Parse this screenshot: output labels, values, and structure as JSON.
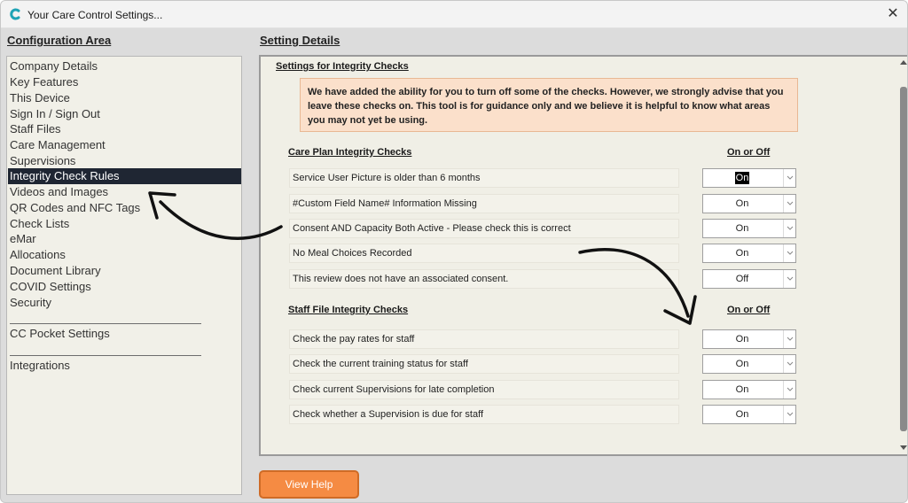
{
  "window": {
    "title": "Your Care Control Settings...",
    "close_label": "✕",
    "logo": "care-control-logo-icon"
  },
  "left": {
    "header": "Configuration Area",
    "items": [
      {
        "label": "Company Details",
        "selected": false
      },
      {
        "label": "Key Features",
        "selected": false
      },
      {
        "label": "This Device",
        "selected": false
      },
      {
        "label": "Sign In / Sign Out",
        "selected": false
      },
      {
        "label": "Staff Files",
        "selected": false
      },
      {
        "label": "Care Management",
        "selected": false
      },
      {
        "label": "Supervisions",
        "selected": false
      },
      {
        "label": "Integrity Check Rules",
        "selected": true
      },
      {
        "label": "Videos and Images",
        "selected": false
      },
      {
        "label": "QR Codes and NFC Tags",
        "selected": false
      },
      {
        "label": "Check Lists",
        "selected": false
      },
      {
        "label": "eMar",
        "selected": false
      },
      {
        "label": "Allocations",
        "selected": false
      },
      {
        "label": "Document Library",
        "selected": false
      },
      {
        "label": "COVID Settings",
        "selected": false
      },
      {
        "label": "Security",
        "selected": false
      }
    ],
    "group2": [
      {
        "label": "CC Pocket Settings"
      }
    ],
    "group3": [
      {
        "label": "Integrations"
      }
    ]
  },
  "right": {
    "header": "Setting Details",
    "settings_title": "Settings for Integrity Checks",
    "notice": "We have added the ability for you to turn off some of the checks.  However, we strongly advise that you leave these checks on.  This tool is for guidance only and we believe it is helpful to know what areas you may not yet be using.",
    "care_plan": {
      "title": "Care Plan Integrity Checks",
      "col_header": "On or Off",
      "rows": [
        {
          "label": "Service User Picture is older than 6 months",
          "value": "On",
          "highlighted": true
        },
        {
          "label": "#Custom Field Name# Information Missing",
          "value": "On",
          "highlighted": false
        },
        {
          "label": "Consent AND Capacity Both Active - Please check this is correct",
          "value": "On",
          "highlighted": false
        },
        {
          "label": "No Meal Choices Recorded",
          "value": "On",
          "highlighted": false
        },
        {
          "label": "This review does not have an associated consent.",
          "value": "Off",
          "highlighted": false
        }
      ]
    },
    "staff_file": {
      "title": "Staff File Integrity Checks",
      "col_header": "On or Off",
      "rows": [
        {
          "label": "Check the pay rates for staff",
          "value": "On"
        },
        {
          "label": "Check the current training status for staff",
          "value": "On"
        },
        {
          "label": "Check current Supervisions for late completion",
          "value": "On"
        },
        {
          "label": "Check whether a Supervision is due for staff",
          "value": "On"
        }
      ]
    }
  },
  "footer": {
    "view_help_label": "View Help"
  },
  "colors": {
    "selected_bg": "#1f2633",
    "notice_bg": "#fbe0cb",
    "button_orange": "#f58b43",
    "logo_teal": "#1fa3b5"
  }
}
